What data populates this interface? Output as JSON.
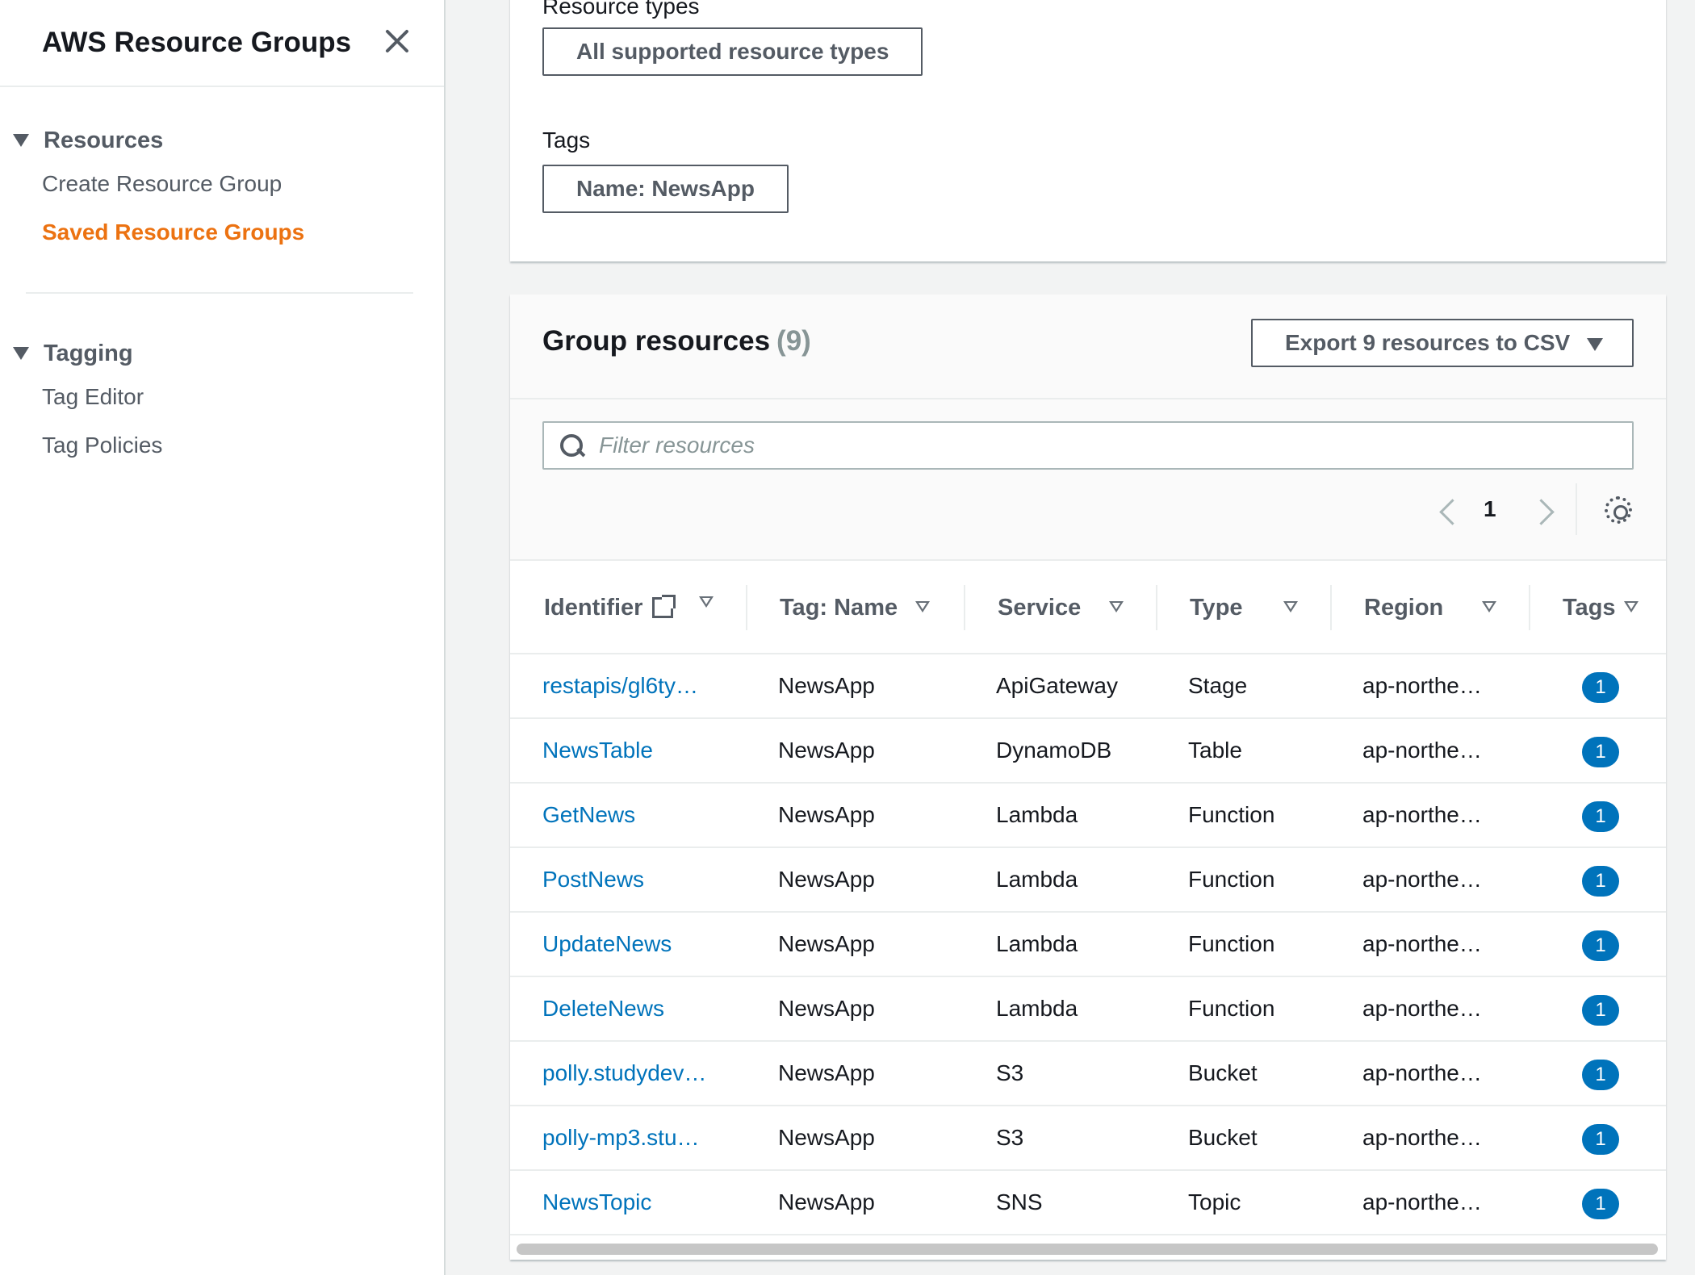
{
  "sidebar": {
    "title": "AWS Resource Groups",
    "sections": [
      {
        "label": "Resources",
        "items": [
          {
            "label": "Create Resource Group",
            "active": false
          },
          {
            "label": "Saved Resource Groups",
            "active": true
          }
        ]
      },
      {
        "label": "Tagging",
        "items": [
          {
            "label": "Tag Editor",
            "active": false
          },
          {
            "label": "Tag Policies",
            "active": false
          }
        ]
      }
    ]
  },
  "query": {
    "resource_types_label": "Resource types",
    "resource_types_value": "All supported resource types",
    "tags_label": "Tags",
    "tags_value": "Name: NewsApp"
  },
  "resources": {
    "title": "Group resources",
    "count": "(9)",
    "export_label": "Export 9 resources to CSV",
    "filter_placeholder": "Filter resources",
    "page": "1",
    "columns": [
      "Identifier",
      "Tag: Name",
      "Service",
      "Type",
      "Region",
      "Tags"
    ],
    "rows": [
      {
        "identifier": "restapis/gl6ty…",
        "tag_name": "NewsApp",
        "service": "ApiGateway",
        "type": "Stage",
        "region": "ap-northe…",
        "tags": "1"
      },
      {
        "identifier": "NewsTable",
        "tag_name": "NewsApp",
        "service": "DynamoDB",
        "type": "Table",
        "region": "ap-northe…",
        "tags": "1"
      },
      {
        "identifier": "GetNews",
        "tag_name": "NewsApp",
        "service": "Lambda",
        "type": "Function",
        "region": "ap-northe…",
        "tags": "1"
      },
      {
        "identifier": "PostNews",
        "tag_name": "NewsApp",
        "service": "Lambda",
        "type": "Function",
        "region": "ap-northe…",
        "tags": "1"
      },
      {
        "identifier": "UpdateNews",
        "tag_name": "NewsApp",
        "service": "Lambda",
        "type": "Function",
        "region": "ap-northe…",
        "tags": "1"
      },
      {
        "identifier": "DeleteNews",
        "tag_name": "NewsApp",
        "service": "Lambda",
        "type": "Function",
        "region": "ap-northe…",
        "tags": "1"
      },
      {
        "identifier": "polly.studydev…",
        "tag_name": "NewsApp",
        "service": "S3",
        "type": "Bucket",
        "region": "ap-northe…",
        "tags": "1"
      },
      {
        "identifier": "polly-mp3.stu…",
        "tag_name": "NewsApp",
        "service": "S3",
        "type": "Bucket",
        "region": "ap-northe…",
        "tags": "1"
      },
      {
        "identifier": "NewsTopic",
        "tag_name": "NewsApp",
        "service": "SNS",
        "type": "Topic",
        "region": "ap-northe…",
        "tags": "1"
      }
    ]
  },
  "colors": {
    "accent_orange": "#ec7211",
    "link_blue": "#0073bb",
    "text_secondary": "#545b64"
  }
}
